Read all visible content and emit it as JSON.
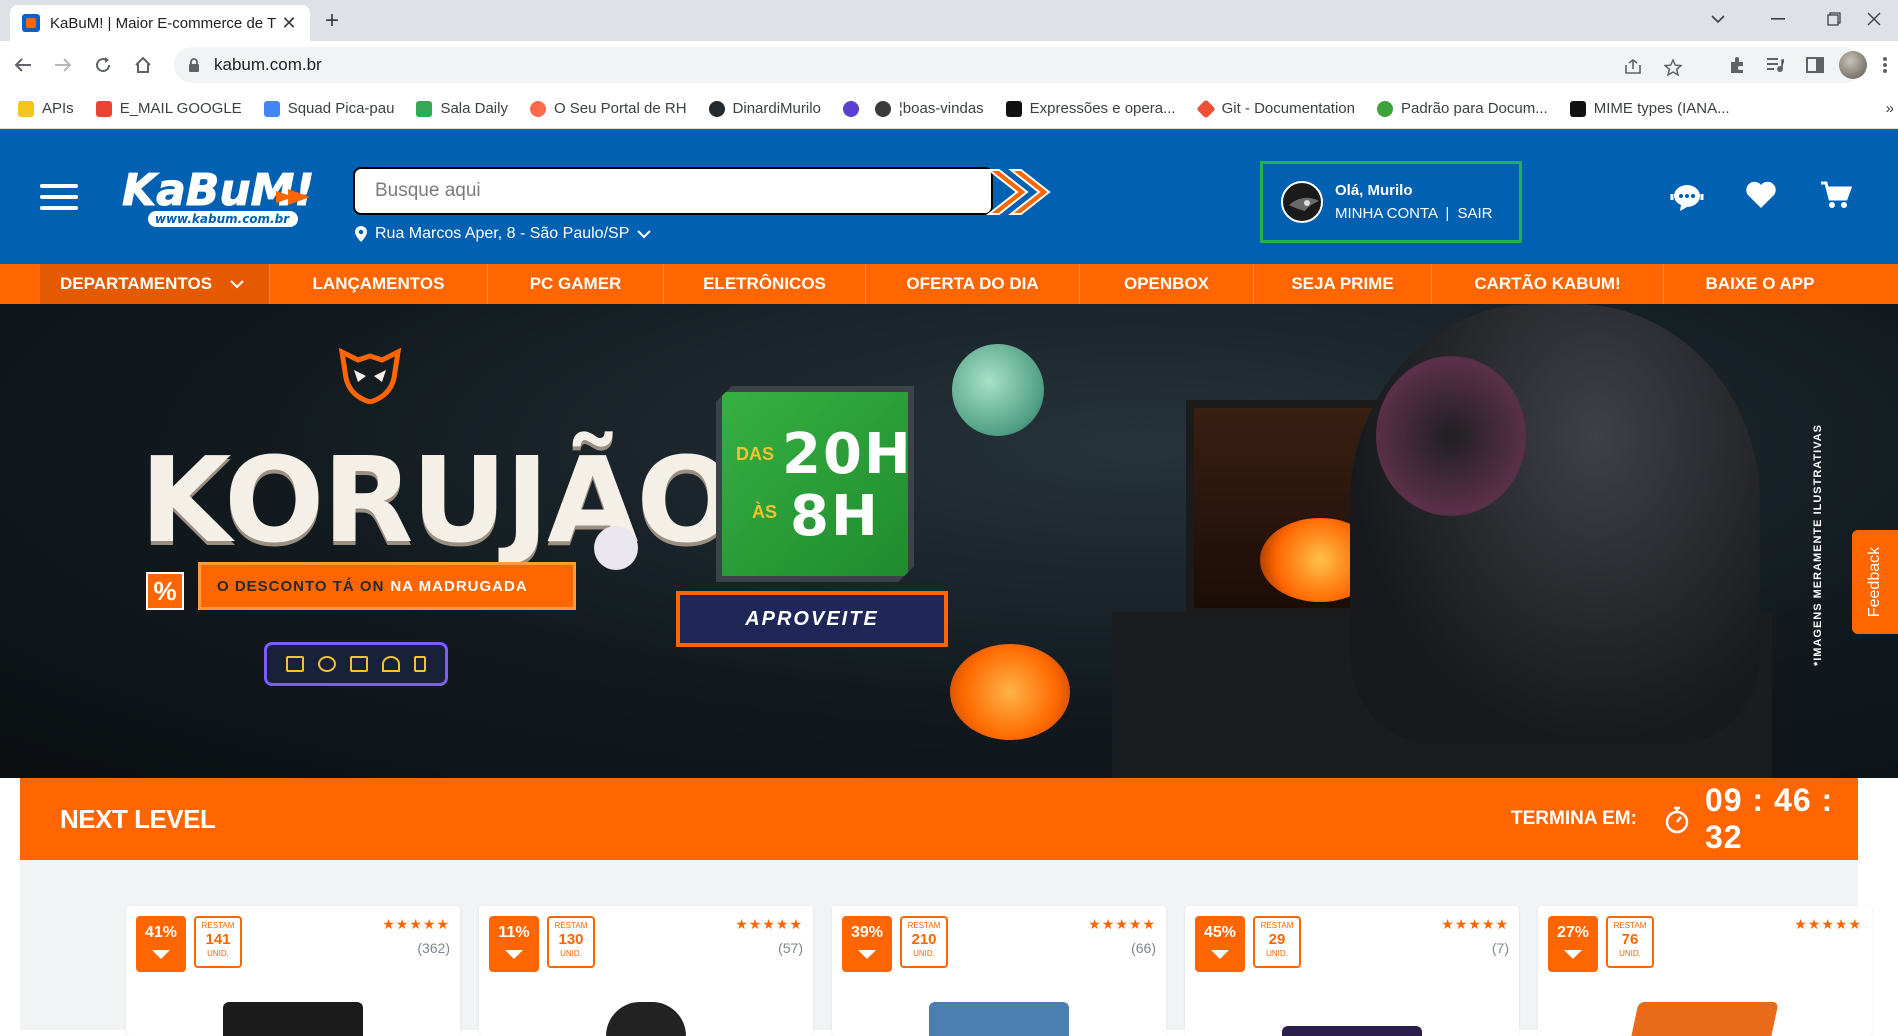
{
  "browser": {
    "tab_title": "KaBuM! | Maior E-commerce de T",
    "url": "kabum.com.br",
    "bookmarks": [
      {
        "label": "APIs",
        "icon": "folder-icon",
        "color": "#f5c518"
      },
      {
        "label": "E_MAIL GOOGLE",
        "icon": "gmail-icon",
        "color": "#ea4335"
      },
      {
        "label": "Squad Pica-pau",
        "icon": "calendar-icon",
        "color": "#4285f4"
      },
      {
        "label": "Sala Daily",
        "icon": "meet-icon",
        "color": "#34a853"
      },
      {
        "label": "O Seu Portal de RH",
        "icon": "portal-icon",
        "color": "#ff6b4a"
      },
      {
        "label": "DinardiMurilo",
        "icon": "github-icon",
        "color": "#24292e"
      },
      {
        "label": "",
        "icon": "badge-icon",
        "color": "#5b3fd1"
      },
      {
        "label": "¦boas-vindas",
        "icon": "bee-icon",
        "color": "#3a3a3a"
      },
      {
        "label": "Expressões e opera...",
        "icon": "mdn-icon",
        "color": "#111111"
      },
      {
        "label": "Git - Documentation",
        "icon": "git-icon",
        "color": "#f05033"
      },
      {
        "label": "Padrão para Docum...",
        "icon": "check-icon",
        "color": "#3ca33a"
      },
      {
        "label": "MIME types (IANA...",
        "icon": "mdn-icon",
        "color": "#111111"
      }
    ],
    "more_bookmarks": "»"
  },
  "header": {
    "logo_text": "KaBuM!",
    "logo_sub": "www.kabum.com.br",
    "search_placeholder": "Busque aqui",
    "location": "Rua Marcos Aper, 8 - São Paulo/SP",
    "account": {
      "greeting": "Olá, Murilo",
      "my_account": "MINHA CONTA",
      "separator": "|",
      "logout": "SAIR"
    }
  },
  "nav": {
    "departments": "DEPARTAMENTOS",
    "items": [
      "LANÇAMENTOS",
      "PC GAMER",
      "ELETRÔNICOS",
      "OFERTA DO DIA",
      "OPENBOX",
      "SEJA PRIME",
      "CARTÃO KABUM!",
      "BAIXE O APP"
    ]
  },
  "banner": {
    "title": "KORUJÃO",
    "percent": "%",
    "subtitle_bold": "O DESCONTO TÁ ON",
    "subtitle_rest": "NA MADRUGADA",
    "das": "DAS",
    "as": "ÀS",
    "time_from": "20H",
    "time_to": "8H",
    "cta": "APROVEITE",
    "disclaimer": "*IMAGENS MERAMENTE ILUSTRATIVAS"
  },
  "feedback": "Feedback",
  "offer": {
    "title": "NEXT LEVEL",
    "ends_label": "TERMINA EM:",
    "timer": "09 : 46 : 32"
  },
  "products": [
    {
      "discount": "41%",
      "stock_label": "RESTAM",
      "stock": "141",
      "unit": "UNID.",
      "stars": "★★★★★",
      "reviews": "(362)",
      "img_color": "#1b1b1b"
    },
    {
      "discount": "11%",
      "stock_label": "RESTAM",
      "stock": "130",
      "unit": "UNID.",
      "stars": "★★★★★",
      "reviews": "(57)",
      "img_color": "#222222"
    },
    {
      "discount": "39%",
      "stock_label": "RESTAM",
      "stock": "210",
      "unit": "UNID.",
      "stars": "★★★★★",
      "reviews": "(66)",
      "img_color": "#4a7fb0"
    },
    {
      "discount": "45%",
      "stock_label": "RESTAM",
      "stock": "29",
      "unit": "UNID.",
      "stars": "★★★★★",
      "reviews": "(7)",
      "img_color": "#2a1f4a"
    },
    {
      "discount": "27%",
      "stock_label": "RESTAM",
      "stock": "76",
      "unit": "UNID.",
      "stars": "★★★★★",
      "reviews": "",
      "img_color": "#e86a1a"
    }
  ]
}
